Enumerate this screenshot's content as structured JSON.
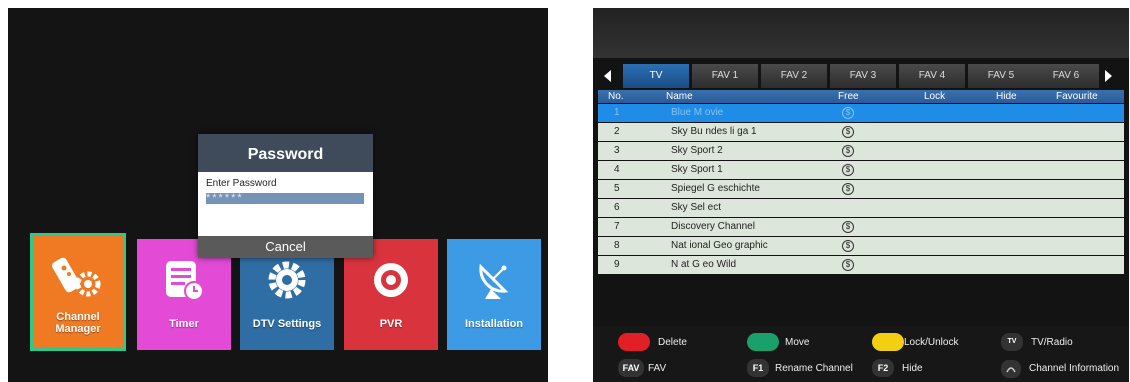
{
  "menu": {
    "tiles": [
      {
        "label": "Channel Manager",
        "icon": "remote-gear-icon"
      },
      {
        "label": "Timer",
        "icon": "list-clock-icon"
      },
      {
        "label": "DTV Settings",
        "icon": "gear-icon"
      },
      {
        "label": "PVR",
        "icon": "record-icon"
      },
      {
        "label": "Installation",
        "icon": "satellite-dish-icon"
      }
    ]
  },
  "password_dialog": {
    "title": "Password",
    "prompt": "Enter Password",
    "value": "******",
    "cancel_label": "Cancel"
  },
  "channel_list": {
    "tabs": [
      "TV",
      "FAV 1",
      "FAV 2",
      "FAV 3",
      "FAV 4",
      "FAV 5",
      "FAV 6"
    ],
    "active_tab": "TV",
    "columns": [
      "No.",
      "Name",
      "Free",
      "Lock",
      "Hide",
      "Favourite"
    ],
    "free_symbol": "$",
    "rows": [
      {
        "no": "1",
        "name": "Blue  M ovie",
        "free": true,
        "selected": true
      },
      {
        "no": "2",
        "name": "Sky Bu ndes li ga  1",
        "free": true
      },
      {
        "no": "3",
        "name": "Sky  Sport   2",
        "free": true
      },
      {
        "no": "4",
        "name": "Sky  Sport   1",
        "free": true
      },
      {
        "no": "5",
        "name": "Spiegel  G eschichte",
        "free": true
      },
      {
        "no": "6",
        "name": "Sky   Sel ect",
        "free": false
      },
      {
        "no": "7",
        "name": "Discovery  Channel",
        "free": true
      },
      {
        "no": "8",
        "name": "Nat ional  Geo graphic",
        "free": true
      },
      {
        "no": "9",
        "name": "N at G eo  Wild",
        "free": true
      }
    ]
  },
  "footer": {
    "delete": "Delete",
    "move": "Move",
    "lock_unlock": "Lock/Unlock",
    "tv_radio_key": "TV",
    "tv_radio": "TV/Radio",
    "fav_key": "FAV",
    "fav": "FAV",
    "f1_key": "F1",
    "rename": "Rename Channel",
    "f2_key": "F2",
    "hide": "Hide",
    "info": "Channel Information",
    "colors": {
      "red": "#e01f26",
      "green": "#1aa06a",
      "yellow": "#f2cf12"
    }
  }
}
